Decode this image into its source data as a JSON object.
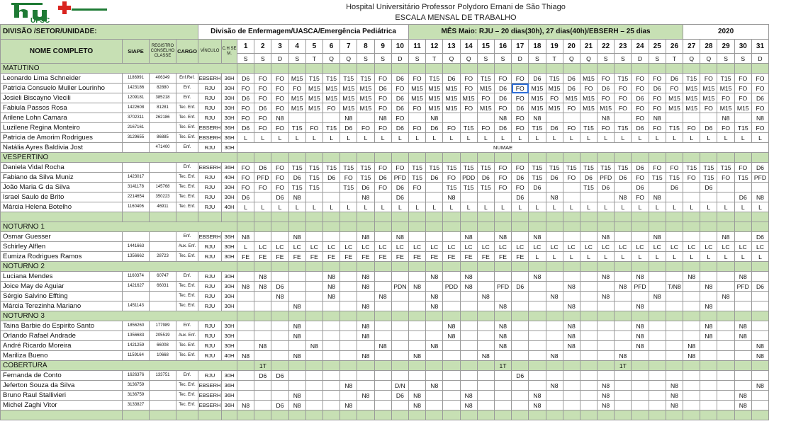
{
  "header": {
    "hospital": "Hospital Universitário Professor Polydoro Ernani de São Thiago",
    "title": "ESCALA MENSAL DE TRABALHO",
    "logo_text": "UFSC"
  },
  "top": {
    "division_label": "DIVISÃO /SETOR/UNIDADE:",
    "division_value": "Divisão de Enfermagem/UASCA/Emergência Pediátrica",
    "month": "MÊS Maio:  RJU – 20 dias(30h), 27 dias(40h)/EBSERH – 25 dias",
    "year": "2020"
  },
  "columns": {
    "name": "NOME COMPLETO",
    "siape": "SIAPE",
    "registro": "REGISTRO CONSELHO CLASSE",
    "cargo": "CARGO",
    "vinculo": "VÍNCULO",
    "ch": "C.H SE M."
  },
  "days": [
    "1",
    "2",
    "3",
    "4",
    "5",
    "6",
    "7",
    "8",
    "9",
    "10",
    "11",
    "12",
    "13",
    "14",
    "15",
    "16",
    "17",
    "18",
    "19",
    "20",
    "21",
    "22",
    "23",
    "24",
    "25",
    "26",
    "27",
    "28",
    "29",
    "30",
    "31"
  ],
  "weekdays": [
    "S",
    "S",
    "D",
    "S",
    "T",
    "Q",
    "Q",
    "S",
    "S",
    "D",
    "S",
    "T",
    "Q",
    "Q",
    "S",
    "S",
    "D",
    "S",
    "T",
    "Q",
    "Q",
    "S",
    "S",
    "D",
    "S",
    "T",
    "Q",
    "Q",
    "S",
    "S",
    "D"
  ],
  "colors": {
    "header_green": "#c7e0b4",
    "logo_green": "#1e7a34",
    "logo_red": "#d9231f",
    "selection": "#2f6fd8"
  },
  "rows": [
    {
      "t": "sec",
      "label": "MATUTINO"
    },
    {
      "t": "p",
      "name": "Leonardo Lima Schneider",
      "siape": "1186991",
      "reg": "406349",
      "cargo": "Enf.Ref.",
      "vinc": "EBSERH",
      "ch": "36H",
      "s": "D6|FO|FO|M15|T15|T15|T15|T15|FO|D6|FO|T15|D6|FO|T15|FO|FO|D6|T15|D6|M15|FO|T15|FO|FO|D6|T15|FO|T15|FO|FO"
    },
    {
      "t": "p",
      "name": "Patricia Consuelo Muller Lourinho",
      "siape": "1423186",
      "reg": "82880",
      "cargo": "Enf.",
      "vinc": "RJU",
      "ch": "30H",
      "s": "FO|FO|FO|FO|M15|M15|M15|M15|D6|FO|M15|M15|M15|FO|M15|D6|FO|M15|M15|D6|FO|D6|FO|FO|D6|FO|M15|M15|M15|FO|FO"
    },
    {
      "t": "p",
      "name": "Josieli Biscayno Viecili",
      "siape": "1209181",
      "reg": "385218",
      "cargo": "Enf.",
      "vinc": "RJU",
      "ch": "30H",
      "s": "D6|FO|FO|M15|M15|M15|M15|M15|FO|D6|M15|M15|M15|M15|FO|D6|FO|M15|FO|M15|M15|FO|FO|D6|FO|M15|M15|M15|FO|FO|D6"
    },
    {
      "t": "p",
      "name": "Fabiula Passos Rosa",
      "siape": "1422608",
      "reg": "81281",
      "cargo": "Tec. Enf.",
      "vinc": "RJU",
      "ch": "30H",
      "s": "FO|D6|FO|M15|M15|FO|M15|M15|FO|D6|FO|M15|M15|FO|M15|FO|D6|M15|M15|FO|M15|M15|FO|FO|FO|M15|M15|FO|M15|M15|FO"
    },
    {
      "t": "p",
      "name": "Arilene Lohn Camara",
      "siape": "3702311",
      "reg": "262186",
      "cargo": "Tec. Enf.",
      "vinc": "RJU",
      "ch": "30H",
      "s": "FO|FO|N8||||N8||N8|FO||N8||||N8|FO|N8||||N8||FO|N8||||N8||N8|FO"
    },
    {
      "t": "p",
      "name": "Luzilene Regina Monteiro",
      "siape": "2167161",
      "reg": "",
      "cargo": "Tec. Enf.",
      "vinc": "EBSERH",
      "ch": "36H",
      "s": "D6|FO|FO|T15|FO|T15|D6|FO|FO|D6|FO|D6|FO|T15|FO|D6|FO|T15|D6|FO|T15|FO|T15|D6|FO|T15|FO|D6|FO|T15|FO"
    },
    {
      "t": "p",
      "name": "Patricia de Amorim Rodrigues",
      "siape": "3129655",
      "reg": "86885",
      "cargo": "Tec. Enf.",
      "vinc": "EBSERH",
      "ch": "36H",
      "s": "L|L|L|L|L|L|L|L|L|L|L|L|L|L|L|L|L|L|L|L|L|L|L|L|L|L|L|L|L|L|L"
    },
    {
      "t": "p",
      "name": "Natália Ayres Baldivia Jost",
      "siape": "",
      "reg": "471400",
      "cargo": "Enf.",
      "vinc": "RJU",
      "ch": "30H",
      "s": "",
      "note": "NUMAE"
    },
    {
      "t": "sec",
      "label": "VESPERTINO"
    },
    {
      "t": "p",
      "name": "Daniela Vidal Rocha",
      "siape": "",
      "reg": "",
      "cargo": "Enf.",
      "vinc": "EBSERH",
      "ch": "36H",
      "s": "FO|D6|FO|T15|T15|T15|T15|T15|FO|FO|T15|T15|T15|T15|T15|FO|FO|T15|T15|T15|T15|T15|T15|D6|FO|FO|T15|T15|T15|FO|D6"
    },
    {
      "t": "p",
      "name": "Fabiano da Silva Muniz",
      "siape": "1423017",
      "reg": "",
      "cargo": "Tec. Enf.",
      "vinc": "RJU",
      "ch": "40H",
      "s": "FO|PFD|FO|D6|T15|D6|FO|T15|D6|PFD|T15|D6|FO|PDD|D6|FO|D6|T15|D6|FO|D6|PFD|D6|FO|T15|T15|FO|T15|FO|T15|PFD"
    },
    {
      "t": "p",
      "name": "João Maria G da Silva",
      "siape": "3141178",
      "reg": "145768",
      "cargo": "Tec. Enf.",
      "vinc": "RJU",
      "ch": "30H",
      "s": "FO|FO|FO|T15|T15||T15|D6|FO|D6|FO||T15|T15|T15|FO|FO|D6|||T15|D6||D6||D6||D6|||"
    },
    {
      "t": "p",
      "name": "Israel Saulo de Brito",
      "siape": "2214654",
      "reg": "350223",
      "cargo": "Tec. Enf.",
      "vinc": "RJU",
      "ch": "30H",
      "s": "D6||D6|N8||||N8||D6|||N8||||D6||N8||||N8|FO|N8|||||D6|N8"
    },
    {
      "t": "p",
      "name": "Márcia Helena Botelho",
      "siape": "1160406",
      "reg": "46911",
      "cargo": "Tec. Enf.",
      "vinc": "RJU",
      "ch": "40H",
      "s": "L|L|L|L|L|L|L|L|L|L|L|L|L|L|L|L|L|L|L|L|L|L|L|L|L|L|L|L|L|L|L"
    },
    {
      "t": "blank"
    },
    {
      "t": "sec",
      "label": "NOTURNO 1"
    },
    {
      "t": "p",
      "name": "Osmar Guesser",
      "siape": "",
      "reg": "",
      "cargo": "Enf.",
      "vinc": "EBSERH",
      "ch": "36H",
      "s": "N8|||N8||||N8||N8||||N8||N8||N8||||N8|||N8||||N8||D6|N8"
    },
    {
      "t": "p",
      "name": "Schirley Alflen",
      "siape": "1441663",
      "reg": "",
      "cargo": "Aux. Enf.",
      "vinc": "RJU",
      "ch": "30H",
      "s": "L|LC|LC|LC|LC|LC|LC|LC|LC|LC|LC|LC|LC|LC|LC|LC|LC|LC|LC|LC|LC|LC|LC|LC|LC|LC|LC|LC|LC|LC|LC"
    },
    {
      "t": "p",
      "name": "Eumiza Rodrigues Ramos",
      "siape": "1356662",
      "reg": "28723",
      "cargo": "Tec. Enf.",
      "vinc": "RJU",
      "ch": "30H",
      "s": "FE|FE|FE|FE|FE|FE|FE|FE|FE|FE|FE|FE|FE|FE|FE|FE|FE|L|L|L|L|L|L|L|L|L|L|L|L|L|L"
    },
    {
      "t": "sec",
      "label": "NOTURNO 2"
    },
    {
      "t": "p",
      "name": "Luciana Mendes",
      "siape": "1160374",
      "reg": "60747",
      "cargo": "Enf.",
      "vinc": "RJU",
      "ch": "30H",
      "s": "|N8||||N8||N8||||N8||N8||||N8||||N8||N8|||N8|||N8|"
    },
    {
      "t": "p",
      "name": "Joice May de Aguiar",
      "siape": "1421627",
      "reg": "66031",
      "cargo": "Tec. Enf.",
      "vinc": "RJU",
      "ch": "30H",
      "s": "N8|N8|D6|||N8||N8||PDN|N8||PDD|N8||PFD|D6|||N8|||N8|PFD||T/N8||N8||PFD|D6"
    },
    {
      "t": "p",
      "name": "Sérgio Salvino Effting",
      "siape": "",
      "reg": "",
      "cargo": "Tec. Enf.",
      "vinc": "RJU",
      "ch": "30H",
      "s": "||N8|||N8|||N8|||N8|||N8||||N8|||N8|||N8||||N8|"
    },
    {
      "t": "p",
      "name": "Márcia Terezinha Mariano",
      "siape": "1451143",
      "reg": "",
      "cargo": "Tec. Enf.",
      "vinc": "RJU",
      "ch": "30H",
      "s": "|||N8||||N8||||N8||||N8||||N8||||N8||||N8||||N8"
    },
    {
      "t": "sec",
      "label": "NOTURNO 3"
    },
    {
      "t": "p",
      "name": "Taina Barbie do Espirito Santo",
      "siape": "1856260",
      "reg": "177989",
      "cargo": "Enf.",
      "vinc": "RJU",
      "ch": "30H",
      "s": "|||N8||||N8|||||N8|||N8||||N8||||N8||||N8||N8"
    },
    {
      "t": "p",
      "name": "Orlando Rafael Andrade",
      "siape": "1356683",
      "reg": "205519",
      "cargo": "Aux. Enf.",
      "vinc": "RJU",
      "ch": "30H",
      "s": "|||N8||||N8|||||N8|||N8||||N8||||N8||||N8||N8"
    },
    {
      "t": "p",
      "name": "André Ricardo Moreira",
      "siape": "1421259",
      "reg": "66008",
      "cargo": "Tec. Enf.",
      "vinc": "RJU",
      "ch": "30H",
      "s": "|N8|||N8||||N8|||N8||||N8||||N8||||N8|||N8||||N8"
    },
    {
      "t": "p",
      "name": "Mariliza Bueno",
      "siape": "1159164",
      "reg": "10668",
      "cargo": "Tec. Enf.",
      "vinc": "RJU",
      "ch": "40H",
      "s": "N8|||N8||||N8|||N8||||N8||||N8||||N8||||N8||||N8"
    },
    {
      "t": "sec",
      "label": "COBERTURA",
      "marks": {
        "2": "1T",
        "16": "1T",
        "23": "1T"
      }
    },
    {
      "t": "p",
      "name": "Fernanda de Conto",
      "siape": "1626376",
      "reg": "133751",
      "cargo": "Enf.",
      "vinc": "RJU",
      "ch": "30H",
      "s": "|D6|D6|||||||||||||||||||||||||||||",
      "m17": "D6"
    },
    {
      "t": "p",
      "name": "Jeferton Souza da Silva",
      "siape": "3136759",
      "reg": "",
      "cargo": "Tec. Enf.",
      "vinc": "EBSERH",
      "ch": "36H",
      "s": "||||||N8|||D/N||N8|||||||N8|||N8||||N8|||||N8|"
    },
    {
      "t": "p",
      "name": "Bruno Raul Stallivieri",
      "siape": "3136759",
      "reg": "",
      "cargo": "Tec. Enf.",
      "vinc": "EBSERH",
      "ch": "36H",
      "s": "|||N8||||N8||D6|N8|||N8||||N8||||N8||||N8||||N8|"
    },
    {
      "t": "p",
      "name": "Michel Zaghi Vitor",
      "siape": "3133827",
      "reg": "",
      "cargo": "Tec. Enf.",
      "vinc": "EBSERH",
      "ch": "36H",
      "s": "N8||D6|N8|||N8||||N8|||N8||||N8||||N8||||N8||||N8"
    },
    {
      "t": "blank"
    }
  ]
}
